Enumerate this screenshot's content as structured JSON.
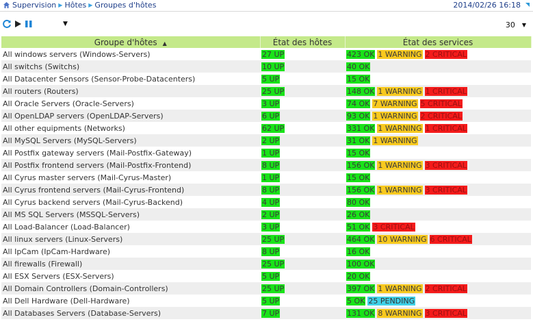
{
  "breadcrumb": {
    "items": [
      "Supervision",
      "Hôtes",
      "Groupes d'hôtes"
    ],
    "datetime": "2014/02/26 16:18"
  },
  "toolbar": {
    "page_size": "30",
    "dropdown_arrow": "▼",
    "icons": [
      "refresh-icon",
      "play-icon",
      "pause-icon"
    ]
  },
  "table": {
    "headers": {
      "group": "Groupe d'hôtes",
      "hosts": "État des hôtes",
      "services": "État des services"
    },
    "rows": [
      {
        "name": "All windows servers (Windows-Servers)",
        "hosts": "27 UP",
        "svc": [
          "423 OK",
          "1 WARNING",
          "2 CRITICAL"
        ]
      },
      {
        "name": "All switchs (Switchs)",
        "hosts": "10 UP",
        "svc": [
          "40 OK"
        ]
      },
      {
        "name": "All Datacenter Sensors (Sensor-Probe-Datacenters)",
        "hosts": "5 UP",
        "svc": [
          "15 OK"
        ]
      },
      {
        "name": "All routers (Routers)",
        "hosts": "25 UP",
        "svc": [
          "148 OK",
          "1 WARNING",
          "1 CRITICAL"
        ]
      },
      {
        "name": "All Oracle Servers (Oracle-Servers)",
        "hosts": "3 UP",
        "svc": [
          "74 OK",
          "7 WARNING",
          "5 CRITICAL"
        ]
      },
      {
        "name": "All OpenLDAP servers (OpenLDAP-Servers)",
        "hosts": "6 UP",
        "svc": [
          "93 OK",
          "1 WARNING",
          "2 CRITICAL"
        ]
      },
      {
        "name": "All other equipments (Networks)",
        "hosts": "62 UP",
        "svc": [
          "331 OK",
          "1 WARNING",
          "1 CRITICAL"
        ]
      },
      {
        "name": "All MySQL Servers (MySQL-Servers)",
        "hosts": "2 UP",
        "svc": [
          "31 OK",
          "1 WARNING"
        ]
      },
      {
        "name": "All Postfix gateway servers (Mail-Postfix-Gateway)",
        "hosts": "1 UP",
        "svc": [
          "15 OK"
        ]
      },
      {
        "name": "All Postfix frontend servers (Mail-Postfix-Frontend)",
        "hosts": "8 UP",
        "svc": [
          "156 OK",
          "1 WARNING",
          "3 CRITICAL"
        ]
      },
      {
        "name": "All Cyrus master servers (Mail-Cyrus-Master)",
        "hosts": "1 UP",
        "svc": [
          "15 OK"
        ]
      },
      {
        "name": "All Cyrus frontend servers (Mail-Cyrus-Frontend)",
        "hosts": "8 UP",
        "svc": [
          "156 OK",
          "1 WARNING",
          "3 CRITICAL"
        ]
      },
      {
        "name": "All Cyrus backend servers (Mail-Cyrus-Backend)",
        "hosts": "4 UP",
        "svc": [
          "80 OK"
        ]
      },
      {
        "name": "All MS SQL Servers (MSSQL-Servers)",
        "hosts": "2 UP",
        "svc": [
          "26 OK"
        ]
      },
      {
        "name": "All Load-Balancer (Load-Balancer)",
        "hosts": "3 UP",
        "svc": [
          "51 OK",
          "3 CRITICAL"
        ]
      },
      {
        "name": "All linux servers (Linux-Servers)",
        "hosts": "25 UP",
        "svc": [
          "464 OK",
          "10 WARNING",
          "6 CRITICAL"
        ]
      },
      {
        "name": "All IpCam (IpCam-Hardware)",
        "hosts": "8 UP",
        "svc": [
          "16 OK"
        ]
      },
      {
        "name": "All firewalls (Firewall)",
        "hosts": "25 UP",
        "svc": [
          "100 OK"
        ]
      },
      {
        "name": "All ESX Servers (ESX-Servers)",
        "hosts": "5 UP",
        "svc": [
          "20 OK"
        ]
      },
      {
        "name": "All Domain Controllers (Domain-Controllers)",
        "hosts": "25 UP",
        "svc": [
          "397 OK",
          "1 WARNING",
          "2 CRITICAL"
        ]
      },
      {
        "name": "All Dell Hardware (Dell-Hardware)",
        "hosts": "5 UP",
        "svc": [
          "5 OK",
          "25 PENDING"
        ]
      },
      {
        "name": "All Databases Servers (Database-Servers)",
        "hosts": "7 UP",
        "svc": [
          "131 OK",
          "8 WARNING",
          "3 CRITICAL"
        ]
      }
    ]
  },
  "colors": {
    "header_bg": "#c4e98a",
    "up_ok": "#19e319",
    "warning": "#f8c91f",
    "critical": "#f41b1b",
    "pending": "#3fd1e8"
  }
}
